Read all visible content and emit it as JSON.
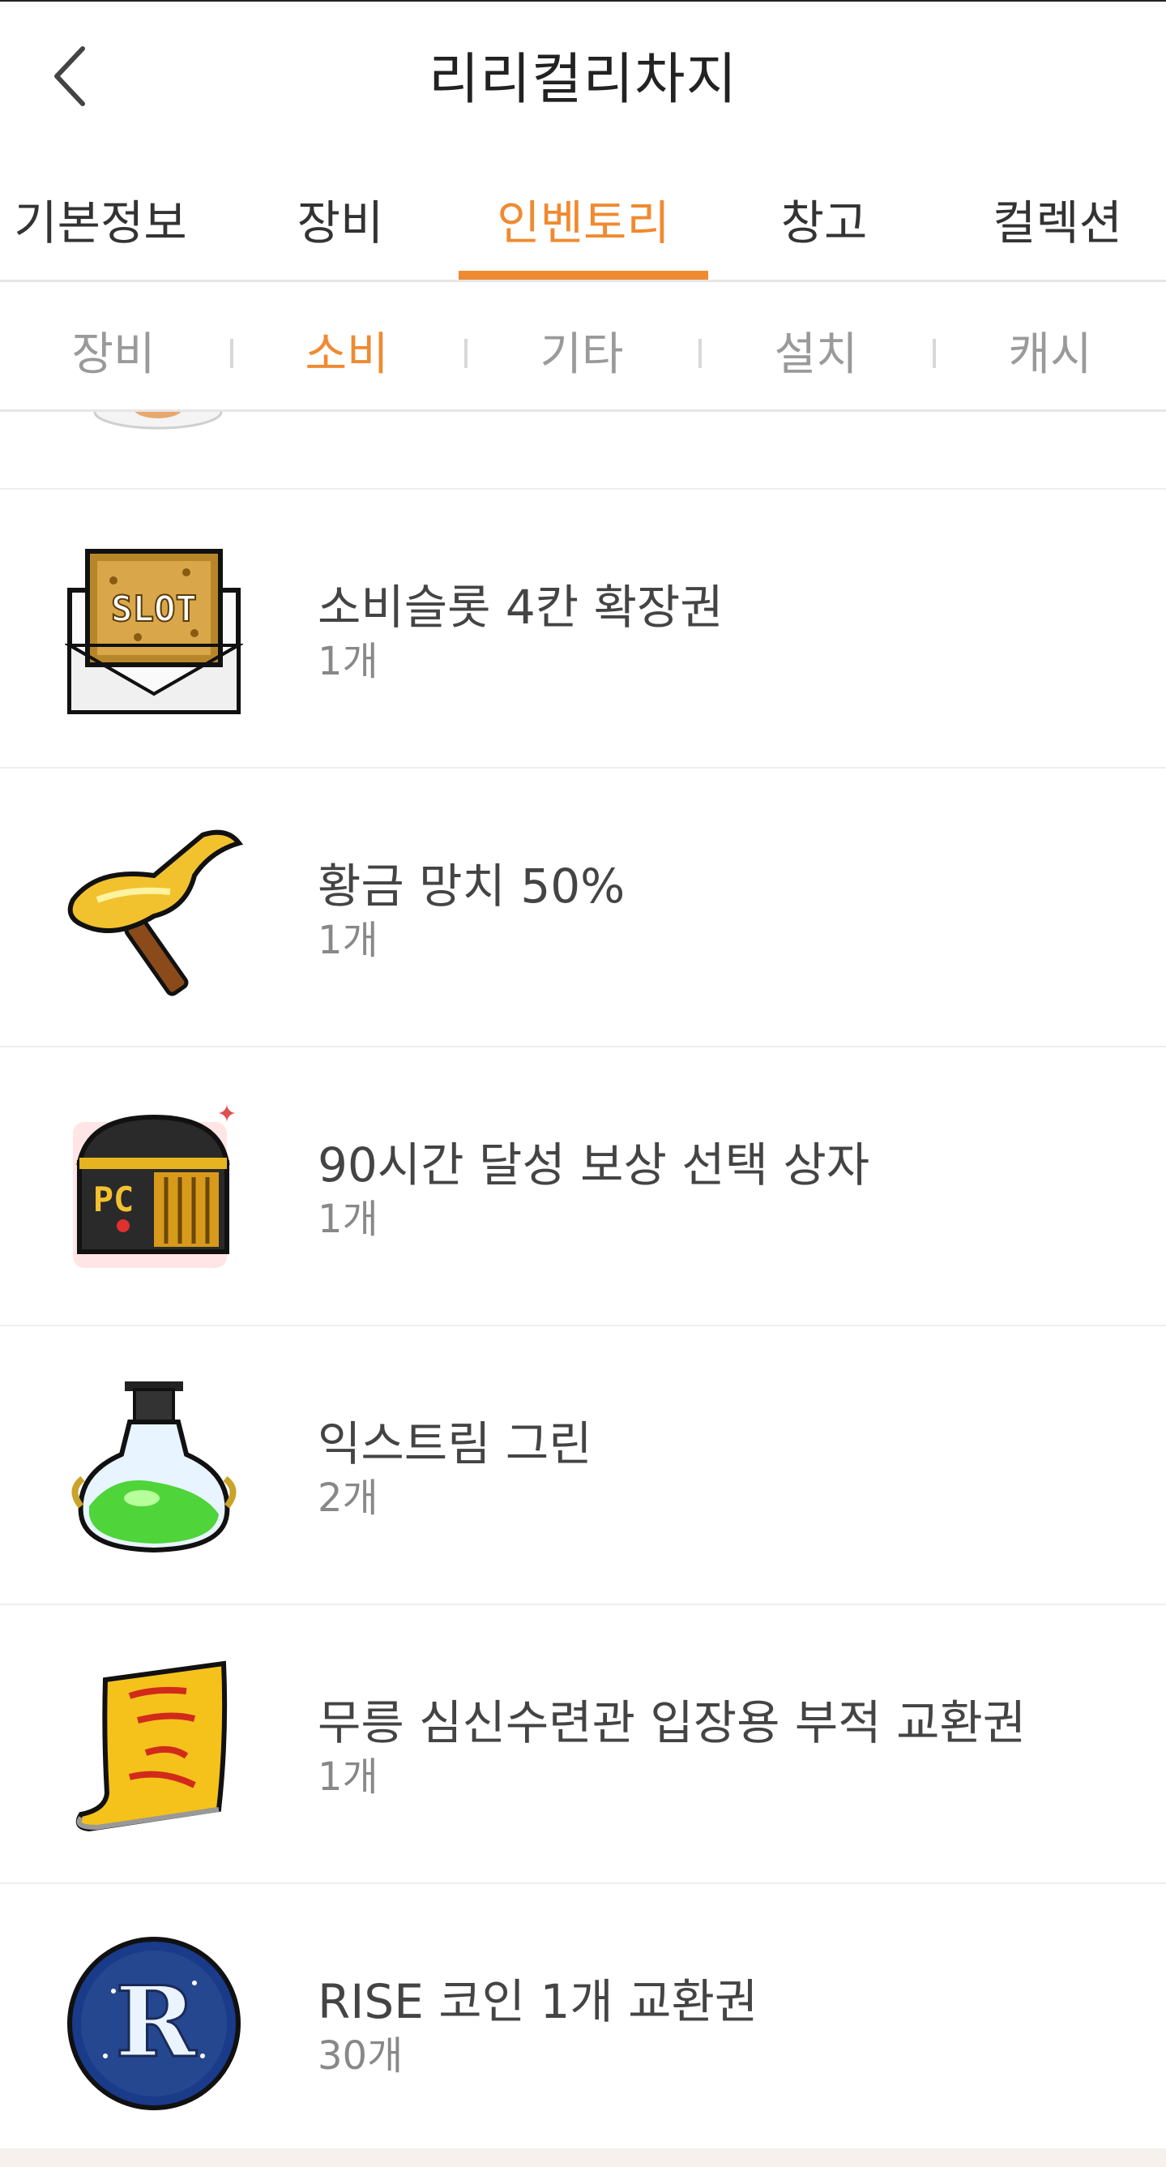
{
  "header": {
    "title": "리리컬리차지"
  },
  "tabs": [
    {
      "label": "기본정보",
      "active": false
    },
    {
      "label": "장비",
      "active": false
    },
    {
      "label": "인벤토리",
      "active": true
    },
    {
      "label": "창고",
      "active": false
    },
    {
      "label": "컬렉션",
      "active": false
    }
  ],
  "subtabs": [
    {
      "label": "장비",
      "active": false
    },
    {
      "label": "소비",
      "active": true
    },
    {
      "label": "기타",
      "active": false
    },
    {
      "label": "설치",
      "active": false
    },
    {
      "label": "캐시",
      "active": false
    }
  ],
  "items": [
    {
      "name": "소비슬롯 4칸 확장권",
      "count": "1개",
      "icon": "slot-envelope-icon"
    },
    {
      "name": "황금 망치 50%",
      "count": "1개",
      "icon": "golden-hammer-icon"
    },
    {
      "name": "90시간 달성 보상 선택 상자",
      "count": "1개",
      "icon": "pc-treasure-chest-icon"
    },
    {
      "name": "익스트림 그린",
      "count": "2개",
      "icon": "green-potion-icon"
    },
    {
      "name": "무릉 심신수련관 입장용 부적 교환권",
      "count": "1개",
      "icon": "yellow-talisman-icon"
    },
    {
      "name": "RISE 코인 1개 교환권",
      "count": "30개",
      "icon": "rise-coin-icon"
    }
  ],
  "colors": {
    "accent": "#f08a30",
    "text": "#444444",
    "muted": "#888888"
  }
}
